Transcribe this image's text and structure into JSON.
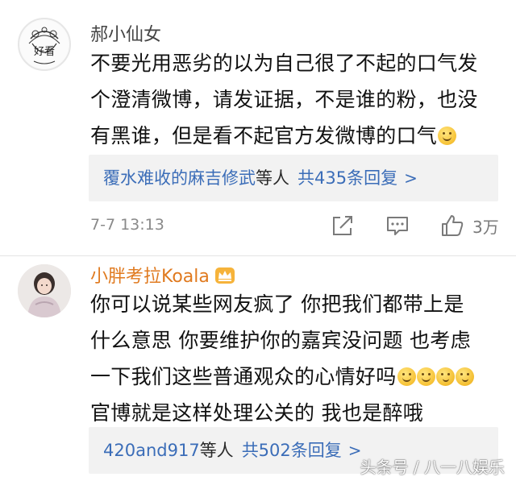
{
  "comment1": {
    "username": "郝小仙女",
    "avatar_text": "好看",
    "text_lines": [
      "不要光用恶劣的以为自己很了不起的口气发",
      "个澄清微博，请发证据，不是谁的粉，也没",
      "有黑谁，但是看不起官方发微博的口气"
    ],
    "reply_users": "覆水难收的麻吉修武",
    "reply_suffix": "等人",
    "reply_count": "共435条回复",
    "reply_chevron": ">",
    "time": "7-7 13:13",
    "like_count": "3万"
  },
  "comment2": {
    "username": "小胖考拉Koala",
    "text_lines": [
      "你可以说某些网友疯了 你把我们都带上是",
      "什么意思 你要维护你的嘉宾没问题 也考虑",
      "一下我们这些普通观众的心情好吗",
      "官博就是这样处理公关的 我也是醉哦"
    ],
    "reply_users": "420and917",
    "reply_suffix": "等人",
    "reply_count": "共502条回复",
    "reply_chevron": ">"
  },
  "watermark": "头条号 / 八一八娱乐",
  "icons": {
    "share": "share-icon",
    "comment": "comment-icon",
    "like": "thumbs-up-icon",
    "vip": "vip-crown-icon",
    "emoji_smile": "smile-emoji-icon",
    "emoji_think": "thinking-emoji-icon"
  },
  "colors": {
    "link": "#3b6db8",
    "vip_name": "#e07a1f",
    "meta": "#8a8a8a"
  }
}
